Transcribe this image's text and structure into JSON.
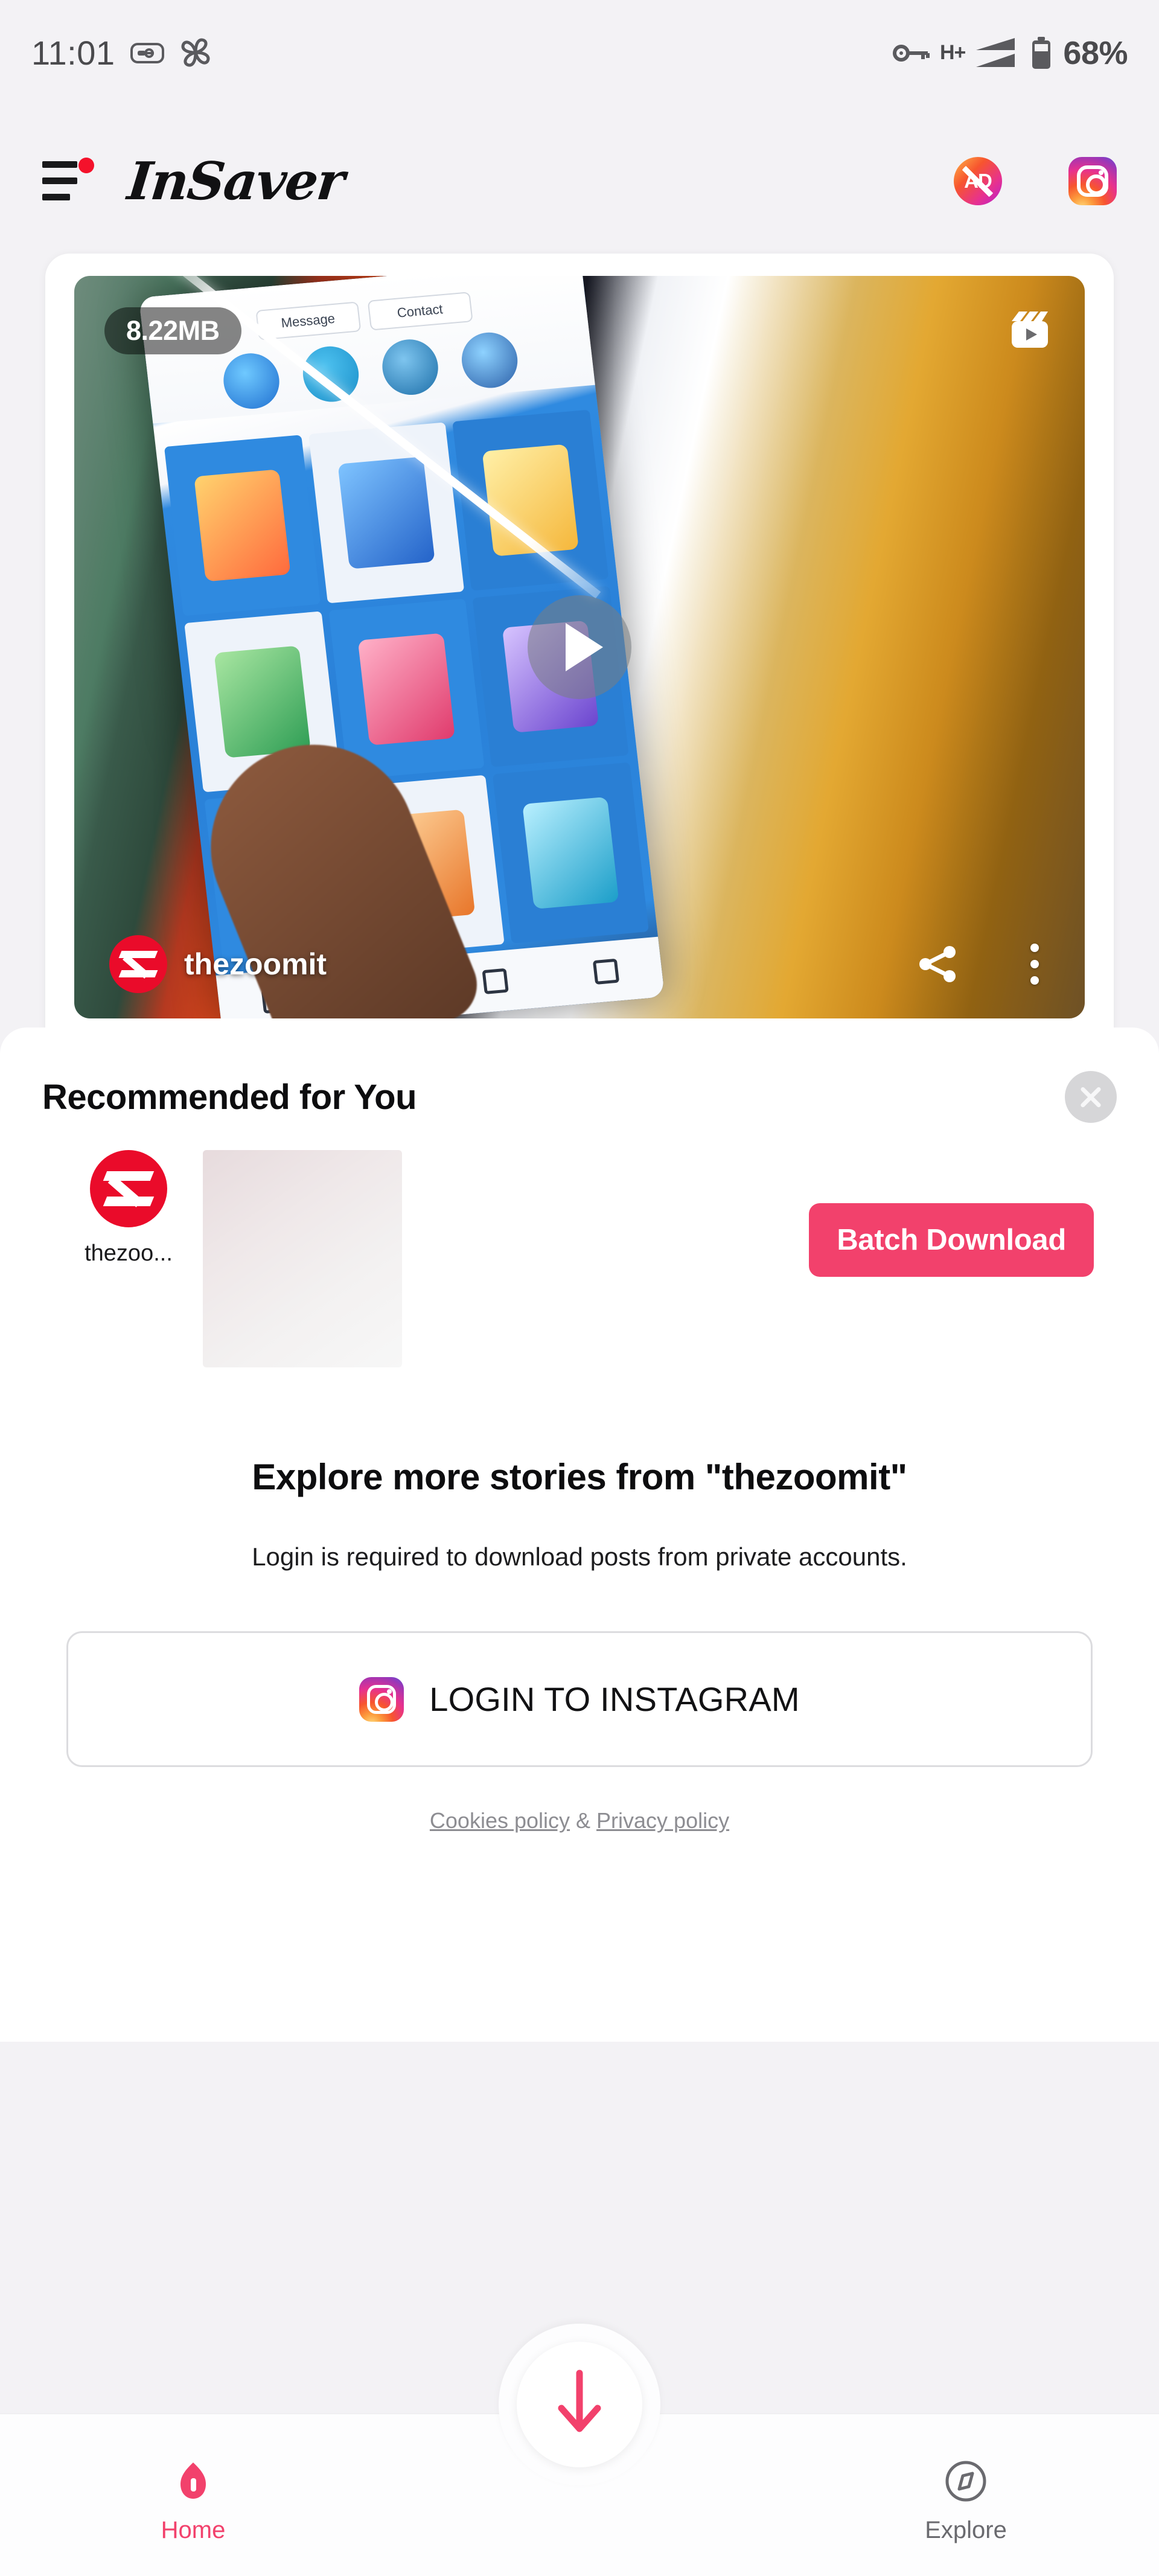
{
  "status_bar": {
    "time": "11:01",
    "left_icons": [
      "screen-record-icon",
      "pinwheel-icon"
    ],
    "right_icons": [
      "vpn-key-icon",
      "signal-bars-icon",
      "battery-icon"
    ],
    "network_type": "H+",
    "battery_percent": "68%"
  },
  "app_bar": {
    "menu_icon": "hamburger-menu-icon",
    "menu_has_notification": true,
    "brand": "InSaver",
    "ad_block_label": "AD",
    "ad_block_icon": "no-ads-icon",
    "instagram_icon": "instagram-icon"
  },
  "media_card": {
    "file_size": "8.22MB",
    "type_icon": "reels-icon",
    "play_icon": "play-icon",
    "username": "thezoomit",
    "avatar_icon": "zoomit-avatar",
    "share_icon": "share-icon",
    "more_icon": "more-vertical-icon"
  },
  "sheet": {
    "title": "Recommended for You",
    "close_icon": "close-icon",
    "account": {
      "name": "thezoo...",
      "avatar_icon": "zoomit-avatar"
    },
    "thumbnail": "story-thumbnail",
    "batch_download_label": "Batch Download",
    "explore_title": "Explore more stories from \"thezoomit\"",
    "explore_subtitle": "Login is required to download posts from private accounts.",
    "login_label": "LOGIN TO INSTAGRAM",
    "login_icon": "instagram-icon",
    "policy_cookies": "Cookies policy",
    "policy_separator": " & ",
    "policy_privacy": "Privacy policy"
  },
  "bottom_nav": {
    "fab_icon": "download-arrow-icon",
    "items": [
      {
        "label": "Home",
        "icon": "home-icon",
        "active": true
      },
      {
        "label": "Explore",
        "icon": "compass-icon",
        "active": false
      }
    ]
  },
  "colors": {
    "accent_pink": "#f2416c",
    "brand_red": "#ea0b2a",
    "page_bg": "#f3f2f5",
    "surface": "#ffffff",
    "text_primary": "#0d0d0f",
    "text_muted": "#8d8d92"
  }
}
